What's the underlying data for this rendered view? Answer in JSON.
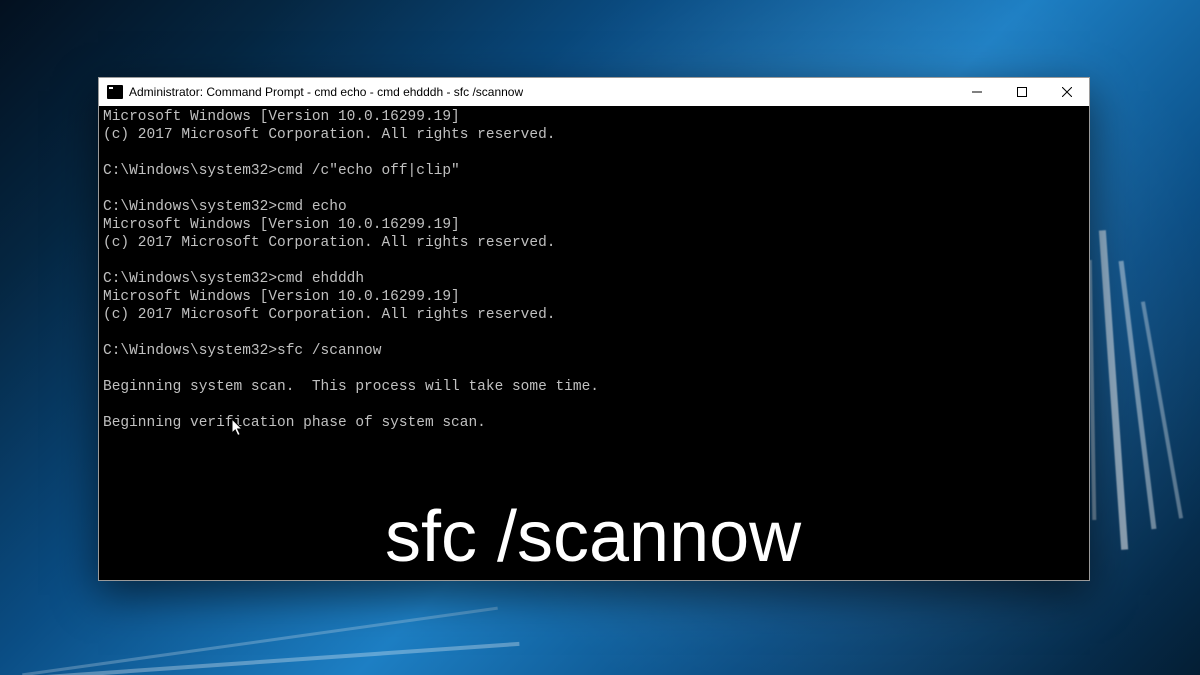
{
  "window": {
    "title": "Administrator: Command Prompt - cmd  echo - cmd  ehdddh - sfc  /scannow"
  },
  "terminal": {
    "lines": [
      "Microsoft Windows [Version 10.0.16299.19]",
      "(c) 2017 Microsoft Corporation. All rights reserved.",
      "",
      "C:\\Windows\\system32>cmd /c\"echo off|clip\"",
      "",
      "C:\\Windows\\system32>cmd echo",
      "Microsoft Windows [Version 10.0.16299.19]",
      "(c) 2017 Microsoft Corporation. All rights reserved.",
      "",
      "C:\\Windows\\system32>cmd ehdddh",
      "Microsoft Windows [Version 10.0.16299.19]",
      "(c) 2017 Microsoft Corporation. All rights reserved.",
      "",
      "C:\\Windows\\system32>sfc /scannow",
      "",
      "Beginning system scan.  This process will take some time.",
      "",
      "Beginning verification phase of system scan."
    ]
  },
  "overlay": {
    "caption": "sfc /scannow"
  }
}
